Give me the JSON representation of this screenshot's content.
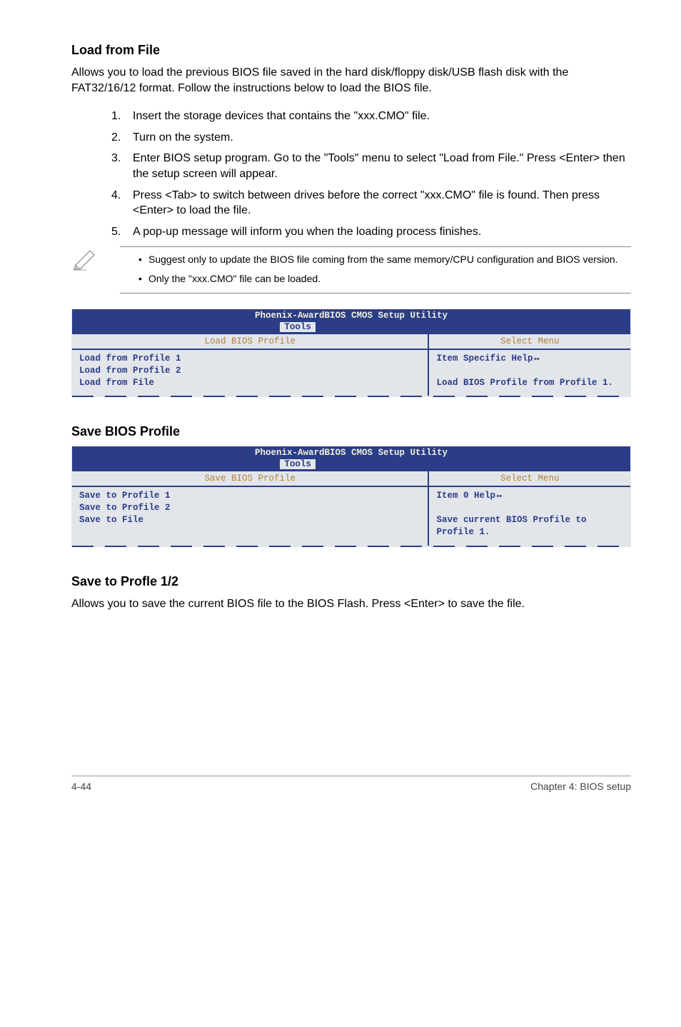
{
  "section1": {
    "title": "Load from File",
    "intro": "Allows you to load the previous BIOS file saved in the hard disk/floppy disk/USB flash disk with the FAT32/16/12 format. Follow the instructions below to load the BIOS file.",
    "steps": [
      "Insert the storage devices that contains the \"xxx.CMO\" file.",
      "Turn on the system.",
      "Enter BIOS setup program. Go to the \"Tools\" menu to select \"Load from File.\" Press <Enter> then the setup screen will appear.",
      "Press <Tab> to switch between drives before the correct \"xxx.CMO\" file is found. Then press <Enter> to load the file.",
      "A pop-up message will inform you when the loading process finishes."
    ],
    "notes": [
      "Suggest only to update the BIOS file coming from the same memory/CPU configuration and BIOS version.",
      "Only the \"xxx.CMO\" file can be loaded."
    ]
  },
  "bios1": {
    "title": "Phoenix-AwardBIOS CMOS Setup Utility",
    "tab": "Tools",
    "main_heading": "Load BIOS Profile",
    "side_heading": "Select Menu",
    "main_lines": [
      "Load from Profile 1",
      "Load from Profile 2",
      "Load from File"
    ],
    "side_line1": "Item Specific Help",
    "side_line2": "Load BIOS Profile from Profile 1."
  },
  "section2": {
    "title": "Save BIOS Profile"
  },
  "bios2": {
    "title": "Phoenix-AwardBIOS CMOS Setup Utility",
    "tab": "Tools",
    "main_heading": "Save BIOS Profile",
    "side_heading": "Select Menu",
    "main_lines": [
      "Save to Profile 1",
      "Save to Profile 2",
      "Save to File"
    ],
    "side_line1": "Item 0 Help",
    "side_line2": "Save current BIOS Profile to Profile 1."
  },
  "section3": {
    "title": "Save to Profle 1/2",
    "body": "Allows you to save the current BIOS file to the BIOS Flash. Press <Enter> to save the file."
  },
  "footer": {
    "left": "4-44",
    "right": "Chapter 4: BIOS setup"
  }
}
